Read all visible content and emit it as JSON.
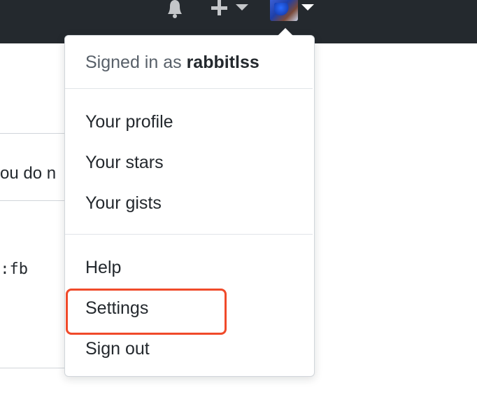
{
  "header": {
    "icons": [
      "bell-icon",
      "plus-icon",
      "avatar"
    ]
  },
  "background": {
    "fragment_text": "ou do n",
    "fragment_code": "o:fb"
  },
  "menu": {
    "signed_in_prefix": "Signed in as",
    "username": "rabbitlss",
    "items": [
      {
        "label": "Your profile"
      },
      {
        "label": "Your stars"
      },
      {
        "label": "Your gists"
      },
      {
        "label": "Help"
      },
      {
        "label": "Settings"
      },
      {
        "label": "Sign out"
      }
    ],
    "highlight_color": "#f04a2a"
  }
}
